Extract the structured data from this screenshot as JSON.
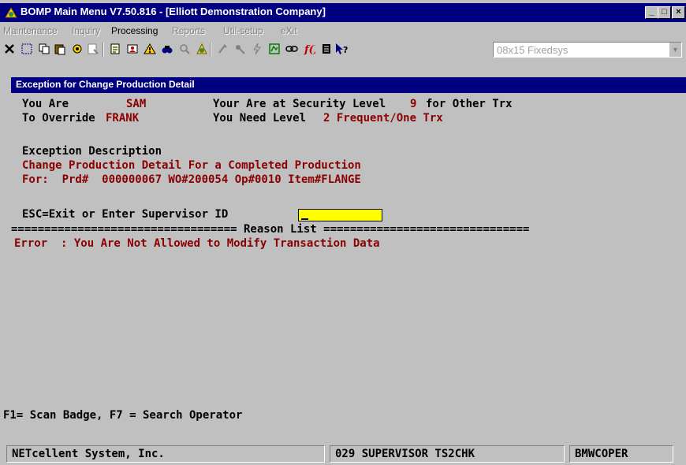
{
  "window": {
    "title": "BOMP Main Menu V7.50.816 - [Elliott Demonstration Company]",
    "controls": {
      "minimize": "_",
      "maximize": "□",
      "close": "×"
    }
  },
  "menu": [
    {
      "label": "Maintenance",
      "enabled": false
    },
    {
      "label": "Inquiry",
      "enabled": false
    },
    {
      "label": "Processing",
      "enabled": true
    },
    {
      "label": "Reports",
      "enabled": false
    },
    {
      "label": "Util-setup",
      "enabled": false
    },
    {
      "label": "eXit",
      "enabled": false
    }
  ],
  "toolbar": {
    "font_select_value": "08x15 Fixedsys"
  },
  "screen": {
    "title": "Exception for Change Production Detail",
    "line1": {
      "label": "You Are",
      "user": "SAM",
      "text": "Your Are at Security Level",
      "level": "9",
      "suffix": "for Other Trx"
    },
    "line2": {
      "label": "To Override",
      "user": "FRANK",
      "text": "You Need Level",
      "level_text": "2 Frequent/One Trx"
    },
    "exception_heading": "Exception Description",
    "exception_desc": "Change Production Detail For a Completed Production",
    "exception_for": "For:  Prd#  000000067 WO#200054 Op#0010 Item#FLANGE",
    "prompt": "ESC=Exit or Enter Supervisor ID",
    "supervisor_id": "",
    "reason_separator": "================================== Reason List ===============================",
    "reason_error": "Error  : You Are Not Allowed to Modify Transaction Data",
    "footer_keys": "F1= Scan Badge, F7 = Search Operator"
  },
  "status": {
    "company": "NETcellent System, Inc.",
    "session": "029 SUPERVISOR TS2CHK",
    "program": "BMWCOPER"
  },
  "colors": {
    "titlebar": "#000080",
    "face": "#c0c0c0",
    "data_red": "#8b0000",
    "input_yellow": "#ffff00"
  }
}
